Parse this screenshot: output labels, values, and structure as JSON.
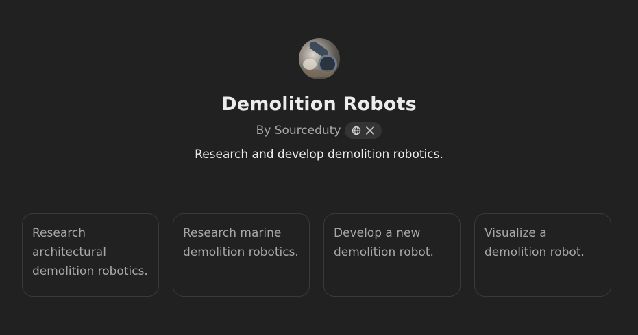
{
  "gpt": {
    "title": "Demolition Robots",
    "author_prefix": "By",
    "author": "Sourceduty",
    "description": "Research and develop demolition robotics.",
    "links": [
      "globe-icon",
      "x-icon"
    ]
  },
  "starters": [
    "Research architectural demolition robotics.",
    "Research marine demolition robotics.",
    "Develop a new demolition robot.",
    "Visualize a demolition robot."
  ],
  "colors": {
    "background": "#212121",
    "text": "#ececec",
    "muted": "#a8a8a8",
    "border": "#3a3a3a",
    "pill": "#343434"
  }
}
